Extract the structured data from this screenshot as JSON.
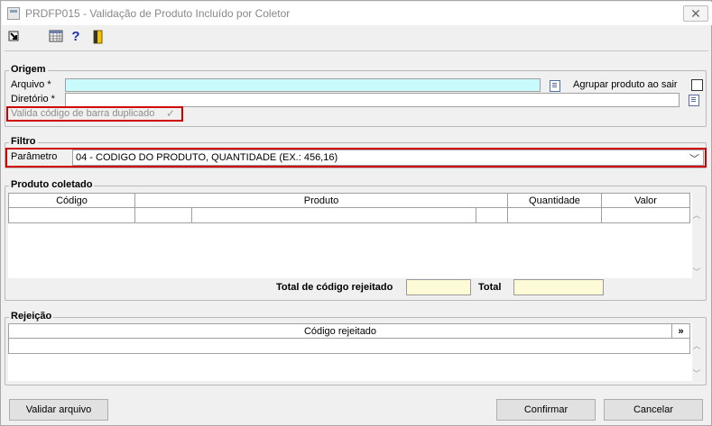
{
  "window": {
    "title": "PRDFP015 - Validação de Produto Incluído por Coletor",
    "close_glyph": "✕"
  },
  "toolbar": {
    "icons": [
      "exit-arrow-icon",
      "calendar-grid-icon",
      "help-icon",
      "door-exit-icon"
    ],
    "help_glyph": "?"
  },
  "origem": {
    "title": "Origem",
    "arquivo_label": "Arquivo *",
    "arquivo_value": "",
    "diretorio_label": "Diretório *",
    "diretorio_value": "",
    "agrupar_label": "Agrupar produto ao sair",
    "valida_label": "Valida código de barra duplicado",
    "check_glyph": "✓"
  },
  "filtro": {
    "title": "Filtro",
    "parametro_label": "Parâmetro",
    "parametro_value": "04 - CODIGO DO PRODUTO, QUANTIDADE (EX.: 456,16)",
    "dropdown_glyph": "﹀"
  },
  "produto": {
    "title": "Produto coletado",
    "columns": [
      "Código",
      "Produto",
      "Quantidade",
      "Valor"
    ],
    "total_rejeitado_label": "Total de código rejeitado",
    "total_label": "Total",
    "total_rejeitado_value": "",
    "total_value": ""
  },
  "rejeicao": {
    "title": "Rejeição",
    "column": "Código rejeitado",
    "expand_glyph": "»"
  },
  "buttons": {
    "validar": "Validar arquivo",
    "confirmar": "Confirmar",
    "cancelar": "Cancelar"
  },
  "scroll": {
    "up": "︿",
    "down": "﹀"
  }
}
